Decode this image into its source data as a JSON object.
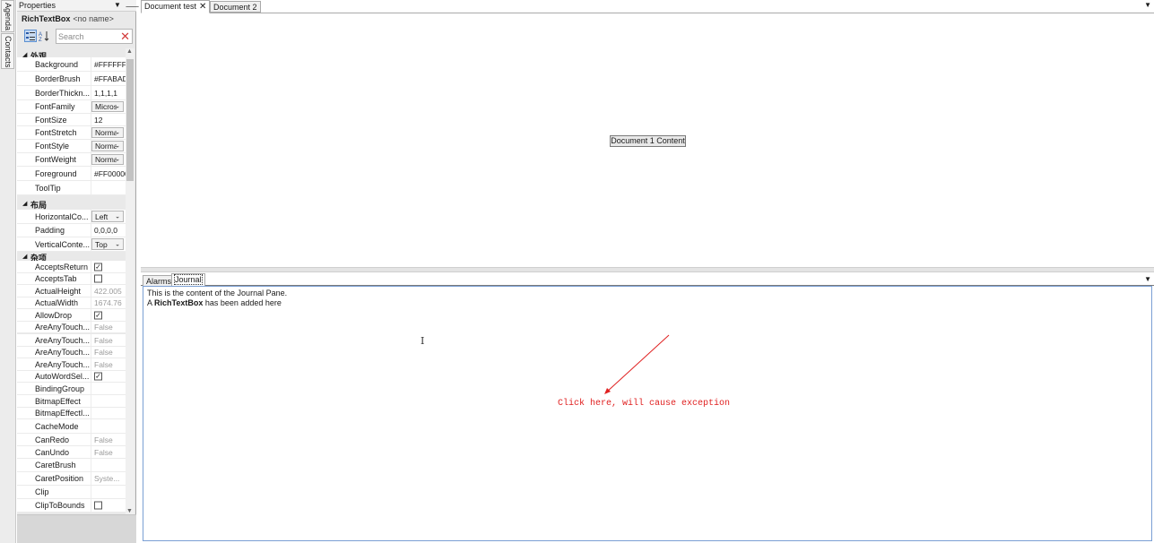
{
  "side_tabs": [
    {
      "label": "Agenda"
    },
    {
      "label": "Contacts"
    }
  ],
  "properties": {
    "title": "Properties",
    "selected_type": "RichTextBox",
    "selected_name": "<no name>",
    "search_placeholder": "Search",
    "categories": [
      {
        "label": "外观",
        "rows": [
          {
            "name": "Background",
            "kind": "text",
            "value": "#FFFFFFFF"
          },
          {
            "name": "BorderBrush",
            "kind": "text",
            "value": "#FFABADB3"
          },
          {
            "name": "BorderThickness",
            "display": "BorderThickn...",
            "kind": "text",
            "value": "1,1,1,1"
          },
          {
            "name": "FontFamily",
            "kind": "combo",
            "value": "Microsoft YaHei UI"
          },
          {
            "name": "FontSize",
            "kind": "text",
            "value": "12"
          },
          {
            "name": "FontStretch",
            "kind": "combo",
            "value": "Normal"
          },
          {
            "name": "FontStyle",
            "kind": "combo",
            "value": "Normal"
          },
          {
            "name": "FontWeight",
            "kind": "combo",
            "value": "Normal"
          },
          {
            "name": "Foreground",
            "kind": "text",
            "value": "#FF000000"
          },
          {
            "name": "ToolTip",
            "kind": "text",
            "value": ""
          }
        ]
      },
      {
        "label": "布局",
        "rows": [
          {
            "name": "HorizontalContentAlignment",
            "display": "HorizontalCo...",
            "kind": "combo",
            "value": "Left"
          },
          {
            "name": "Padding",
            "kind": "text",
            "value": "0,0,0,0"
          },
          {
            "name": "VerticalContentAlignment",
            "display": "VerticalConte...",
            "kind": "combo",
            "value": "Top"
          }
        ]
      },
      {
        "label": "杂项",
        "rows": [
          {
            "name": "AcceptsReturn",
            "kind": "check",
            "checked": true
          },
          {
            "name": "AcceptsTab",
            "kind": "check",
            "checked": false
          },
          {
            "name": "ActualHeight",
            "kind": "readonly",
            "value": "422.005"
          },
          {
            "name": "ActualWidth",
            "kind": "readonly",
            "value": "1674.76"
          },
          {
            "name": "AllowDrop",
            "kind": "check",
            "checked": true
          },
          {
            "name": "AreAnyTouch...",
            "kind": "readonly",
            "value": "False"
          },
          {
            "name": "AreAnyTouch...",
            "kind": "readonly",
            "value": "False"
          },
          {
            "name": "AreAnyTouch...",
            "kind": "readonly",
            "value": "False"
          },
          {
            "name": "AreAnyTouch...",
            "kind": "readonly",
            "value": "False"
          },
          {
            "name": "AutoWordSel...",
            "kind": "check",
            "checked": true
          },
          {
            "name": "BindingGroup",
            "kind": "text",
            "value": ""
          },
          {
            "name": "BitmapEffect",
            "kind": "text",
            "value": ""
          },
          {
            "name": "BitmapEffectI...",
            "kind": "text",
            "value": ""
          },
          {
            "name": "CacheMode",
            "kind": "text",
            "value": ""
          },
          {
            "name": "CanRedo",
            "kind": "readonly",
            "value": "False"
          },
          {
            "name": "CanUndo",
            "kind": "readonly",
            "value": "False"
          },
          {
            "name": "CaretBrush",
            "kind": "text",
            "value": ""
          },
          {
            "name": "CaretPosition",
            "kind": "readonly",
            "value": "Syste..."
          },
          {
            "name": "Clip",
            "kind": "text",
            "value": ""
          },
          {
            "name": "ClipToBounds",
            "kind": "check",
            "checked": false
          }
        ]
      }
    ]
  },
  "document_tabs": [
    {
      "label": "Document test",
      "active": true,
      "closable": true
    },
    {
      "label": "Document 2",
      "active": false,
      "closable": false
    }
  ],
  "document_content_label": "Document 1 Content",
  "bottom_tabs": [
    {
      "label": "Alarms",
      "active": false
    },
    {
      "label": "Journal",
      "active": true
    }
  ],
  "journal": {
    "line1": "This is the content of the Journal Pane.",
    "line2_prefix": "A ",
    "line2_bold": "RichTextBox",
    "line2_suffix": " has been added here"
  },
  "annotation": {
    "text": "Click here, will cause exception",
    "color": "#e02020"
  },
  "colors": {
    "accent_selection": "#c7daf1",
    "text_box_border": "#7a9fd4"
  }
}
